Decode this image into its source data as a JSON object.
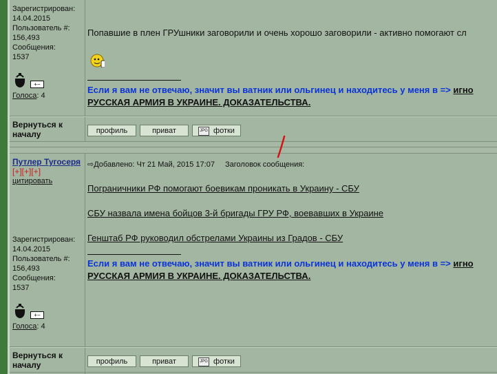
{
  "post1": {
    "profile": {
      "registered_label": "Зарегистрирован:",
      "registered_date": "14.04.2015",
      "user_num_label": "Пользователь #:",
      "user_num": "156,493",
      "messages_label": "Сообщения:",
      "messages": "1537",
      "votes_link": "Голоса",
      "votes_count": ": 4"
    },
    "text": "Попавшие в плен ГРУшники заговорили и очень хорошо заговорили - активно помогают сл",
    "signature": {
      "line1": "Если я вам не отвечаю, значит вы ватник или ольгинец и находитесь у меня в =>",
      "line1_tail": "игно",
      "line2": "РУССКАЯ АРМИЯ В УКРАИНЕ. ДОКАЗАТЕЛЬСТВА."
    },
    "back_to_top": "Вернуться к началу",
    "buttons": {
      "profile": "профиль",
      "pm": "приват",
      "photos": "фотки"
    }
  },
  "post2": {
    "author": "Путлер Тугосеря",
    "reputation": "[+][+][+]",
    "quote": "цитировать",
    "meta": {
      "added": "Добавлено: Чт 21 Май, 2015 17:07",
      "subject": "Заголовок сообщения:"
    },
    "links": [
      "Пограничники РФ помогают боевикам проникать в Украину - СБУ",
      "СБУ назвала имена бойцов 3-й бригады ГРУ РФ, воевавших в Украине",
      "Генштаб РФ руководил обстрелами Украины из Градов - СБУ"
    ],
    "profile": {
      "registered_label": "Зарегистрирован:",
      "registered_date": "14.04.2015",
      "user_num_label": "Пользователь #:",
      "user_num": "156,493",
      "messages_label": "Сообщения:",
      "messages": "1537",
      "votes_link": "Голоса",
      "votes_count": ": 4"
    },
    "signature": {
      "line1": "Если я вам не отвечаю, значит вы ватник или ольгинец и находитесь у меня в =>",
      "line1_tail": "игно",
      "line2": "РУССКАЯ АРМИЯ В УКРАИНЕ. ДОКАЗАТЕЛЬСТВА."
    },
    "back_to_top": "Вернуться к началу",
    "buttons": {
      "profile": "профиль",
      "pm": "приват",
      "photos": "фотки"
    }
  },
  "colors": {
    "background": "#a3b6a1",
    "signature_blue": "#0a33d8",
    "reputation_red": "#cc1b1b",
    "left_bar": "#3e7a3a"
  }
}
